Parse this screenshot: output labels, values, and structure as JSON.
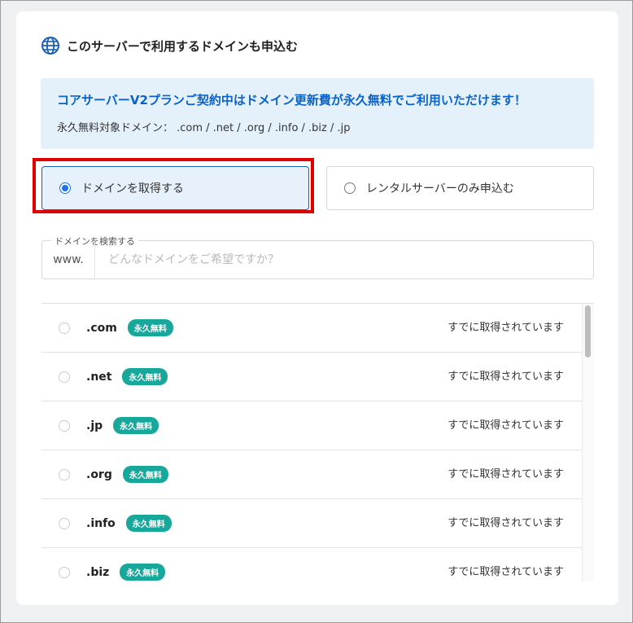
{
  "header": {
    "title": "このサーバーで利用するドメインも申込む",
    "icon": "globe-icon"
  },
  "info": {
    "title": "コアサーバーV2プランご契約中はドメイン更新費が永久無料でご利用いただけます！",
    "subtitle": "永久無料対象ドメイン： .com / .net / .org / .info / .biz / .jp"
  },
  "options": [
    {
      "label": "ドメインを取得する",
      "selected": true
    },
    {
      "label": "レンタルサーバーのみ申込む",
      "selected": false
    }
  ],
  "search": {
    "legend": "ドメインを検索する",
    "prefix": "www.",
    "placeholder": "どんなドメインをご希望ですか？",
    "value": ""
  },
  "domains": [
    {
      "tld": ".com",
      "badge": "永久無料",
      "status": "すでに取得されています"
    },
    {
      "tld": ".net",
      "badge": "永久無料",
      "status": "すでに取得されています"
    },
    {
      "tld": ".jp",
      "badge": "永久無料",
      "status": "すでに取得されています"
    },
    {
      "tld": ".org",
      "badge": "永久無料",
      "status": "すでに取得されています"
    },
    {
      "tld": ".info",
      "badge": "永久無料",
      "status": "すでに取得されています"
    },
    {
      "tld": ".biz",
      "badge": "永久無料",
      "status": "すでに取得されています"
    }
  ],
  "colors": {
    "accent": "#1a73e8",
    "info_title": "#0a63c8",
    "badge": "#17a89b",
    "highlight": "#e00000"
  }
}
